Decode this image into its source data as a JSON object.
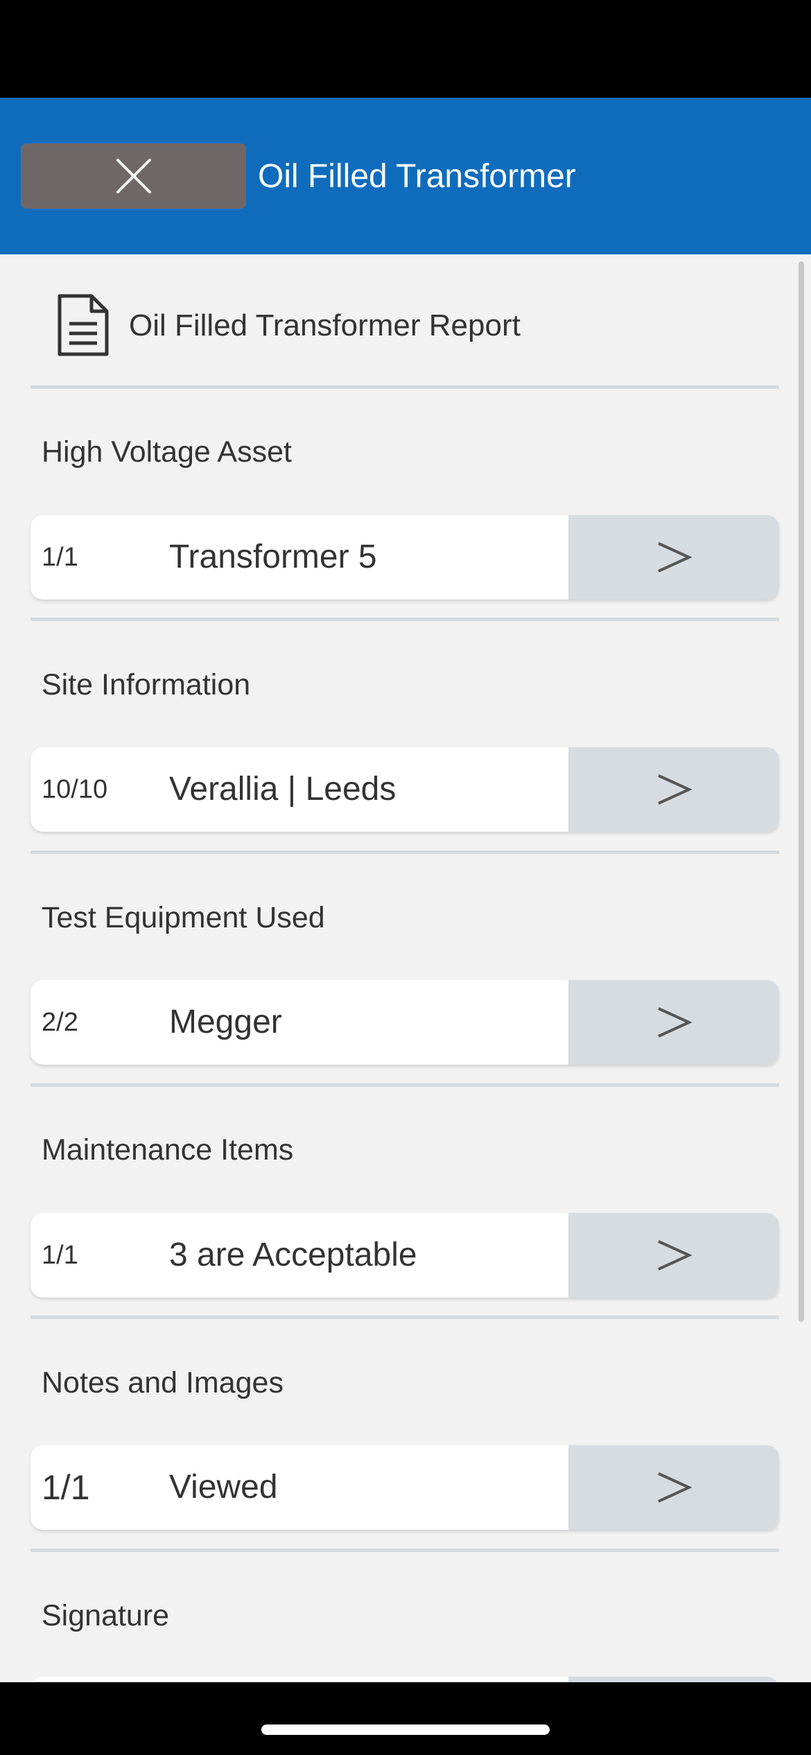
{
  "header": {
    "title": "Oil Filled Transformer",
    "close_icon": "close-icon",
    "accent_color": "#0f6cbd"
  },
  "report": {
    "title": "Oil Filled Transformer Report",
    "icon": "document-icon"
  },
  "sections": [
    {
      "label": "High Voltage Asset",
      "count": "1/1",
      "value": "Transformer 5"
    },
    {
      "label": "Site Information",
      "count": "10/10",
      "value": "Verallia | Leeds"
    },
    {
      "label": "Test Equipment Used",
      "count": "2/2",
      "value": "Megger"
    },
    {
      "label": "Maintenance Items",
      "count": "1/1",
      "value": "3 are Acceptable"
    },
    {
      "label": "Notes and Images",
      "count": "1/1",
      "value": "Viewed"
    },
    {
      "label": "Signature",
      "count": "",
      "value": ""
    }
  ],
  "arrow_icon": "chevron-right-icon"
}
